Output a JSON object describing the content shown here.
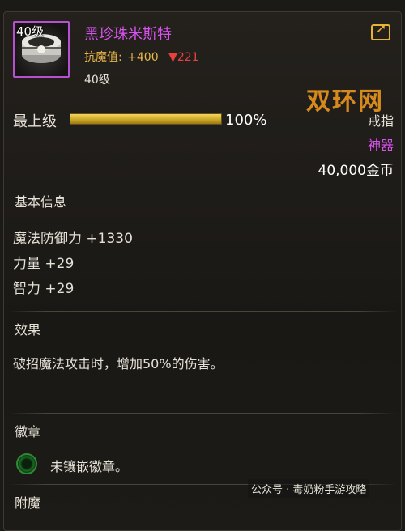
{
  "item": {
    "level_tag": "40级",
    "name": "黑珍珠米斯特",
    "resist_label": "抗魔值:",
    "resist_value": "+400",
    "resist_down": "▼221",
    "required_level": "40级",
    "grade_label": "最上级",
    "grade_percent": "100%",
    "grade_fill": 1.0,
    "type": "戒指",
    "rarity": "神器",
    "price": "40,000金币"
  },
  "watermark": "双环网",
  "sections": {
    "basic_title": "基本信息",
    "stats": [
      "魔法防御力 +1330",
      "力量 +29",
      "智力 +29"
    ],
    "effect_title": "效果",
    "effect_text": "破招魔法攻击时，增加50%的伤害。",
    "emblem_title": "徽章",
    "emblem_text": "未镶嵌徽章。",
    "next_title": "附魔"
  },
  "footer": "公众号 · 毒奶粉手游攻略",
  "colors": {
    "epic": "#d852f0",
    "gold": "#e9b84a",
    "down": "#e8413b"
  }
}
